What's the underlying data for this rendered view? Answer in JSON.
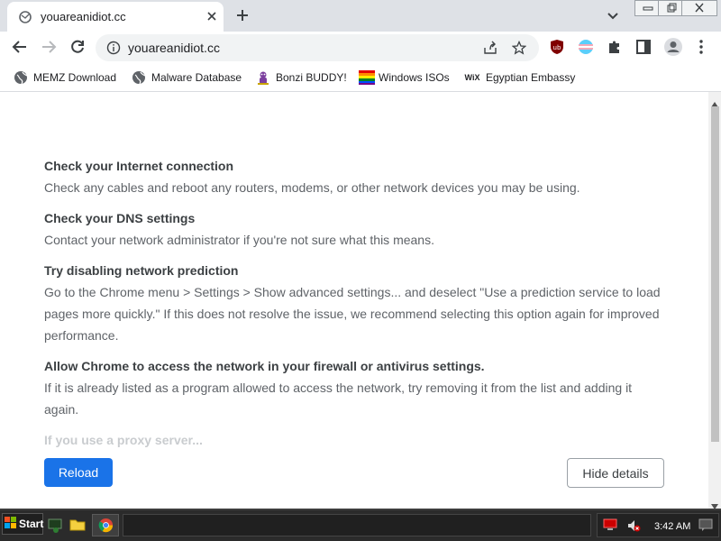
{
  "tab": {
    "title": "youareanidiot.cc"
  },
  "address_bar": {
    "url": "youareanidiot.cc"
  },
  "bookmarks": [
    {
      "label": "MEMZ Download",
      "icon": "globe-icon"
    },
    {
      "label": "Malware Database",
      "icon": "globe-icon"
    },
    {
      "label": "Bonzi BUDDY!",
      "icon": "bonzi-icon"
    },
    {
      "label": "Windows ISOs",
      "icon": "windows-flag-icon"
    },
    {
      "label": "Egyptian Embassy",
      "icon": "wix-icon",
      "icon_text": "WiX"
    }
  ],
  "sections": [
    {
      "heading": "Check your Internet connection",
      "body": "Check any cables and reboot any routers, modems, or other network devices you may be using."
    },
    {
      "heading": "Check your DNS settings",
      "body": "Contact your network administrator if you're not sure what this means."
    },
    {
      "heading": "Try disabling network prediction",
      "body": "Go to the Chrome menu > Settings > Show advanced settings... and deselect \"Use a prediction service to load pages more quickly.\" If this does not resolve the issue, we recommend selecting this option again for improved performance."
    },
    {
      "heading": "Allow Chrome to access the network in your firewall or antivirus settings.",
      "body": "If it is already listed as a program allowed to access the network, try removing it from the list and adding it again."
    },
    {
      "heading": "If you use a proxy server..."
    }
  ],
  "buttons": {
    "reload": "Reload",
    "hide_details": "Hide details"
  },
  "taskbar": {
    "start_label": "Start",
    "clock": "3:42 AM"
  },
  "colors": {
    "accent": "#1a73e8",
    "tabstrip": "#dee1e6",
    "omnibox": "#f1f3f4",
    "taskbar": "#2b2b2b"
  }
}
